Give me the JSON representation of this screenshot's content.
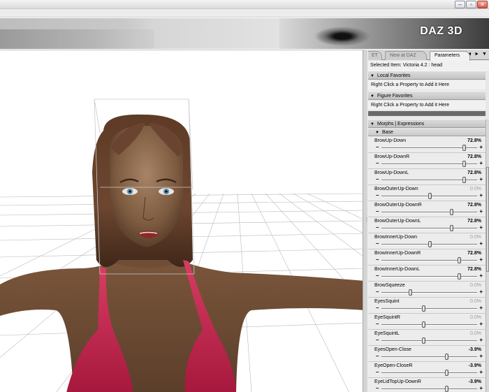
{
  "window": {
    "buttons": [
      "–",
      "▫",
      "✕"
    ]
  },
  "banner": {
    "logo": "DAZ 3D"
  },
  "panel": {
    "tabs": [
      {
        "label": "ET",
        "active": false
      },
      {
        "label": "New at DAZ",
        "active": false
      },
      {
        "label": "Parameters",
        "active": true
      }
    ],
    "tab_arrows": "◄ ► ▼",
    "selected_item": "Selected Item:  Victoria 4.2 : head",
    "local_favorites": {
      "title": "Local Favorites",
      "hint": "Right Click a Property to Add it Here"
    },
    "figure_favorites": {
      "title": "Figure Favorites",
      "hint": "Right Click a Property to Add it Here"
    },
    "morphs_header": "Morphs | Expressions",
    "base_header": "Base",
    "params": [
      {
        "name": "BrowUp-Down",
        "value": "72.8%",
        "level": 0.86
      },
      {
        "name": "BrowUp-DownR",
        "value": "72.8%",
        "level": 0.86
      },
      {
        "name": "BrowUp-DownL",
        "value": "72.8%",
        "level": 0.86
      },
      {
        "name": "BrowOuterUp-Down",
        "value": "0.0%",
        "level": 0.5
      },
      {
        "name": "BrowOuterUp-DownR",
        "value": "72.8%",
        "level": 0.73
      },
      {
        "name": "BrowOuterUp-DownL",
        "value": "72.8%",
        "level": 0.73
      },
      {
        "name": "BrowInnerUp-Down",
        "value": "0.0%",
        "level": 0.5
      },
      {
        "name": "BrowInnerUp-DownR",
        "value": "72.8%",
        "level": 0.81
      },
      {
        "name": "BrowInnerUp-DownL",
        "value": "72.8%",
        "level": 0.81
      },
      {
        "name": "BrowSqueeze",
        "value": "0.0%",
        "level": 0.3
      },
      {
        "name": "EyesSquint",
        "value": "0.0%",
        "level": 0.44
      },
      {
        "name": "EyeSquintR",
        "value": "0.0%",
        "level": 0.44
      },
      {
        "name": "EyeSquintL",
        "value": "0.0%",
        "level": 0.44
      },
      {
        "name": "EyesOpen-Close",
        "value": "-3.9%",
        "level": 0.68
      },
      {
        "name": "EyeOpen-CloseR",
        "value": "-3.9%",
        "level": 0.68
      },
      {
        "name": "EyeLidTopUp-DownR",
        "value": "-3.9%",
        "level": 0.68
      }
    ]
  }
}
